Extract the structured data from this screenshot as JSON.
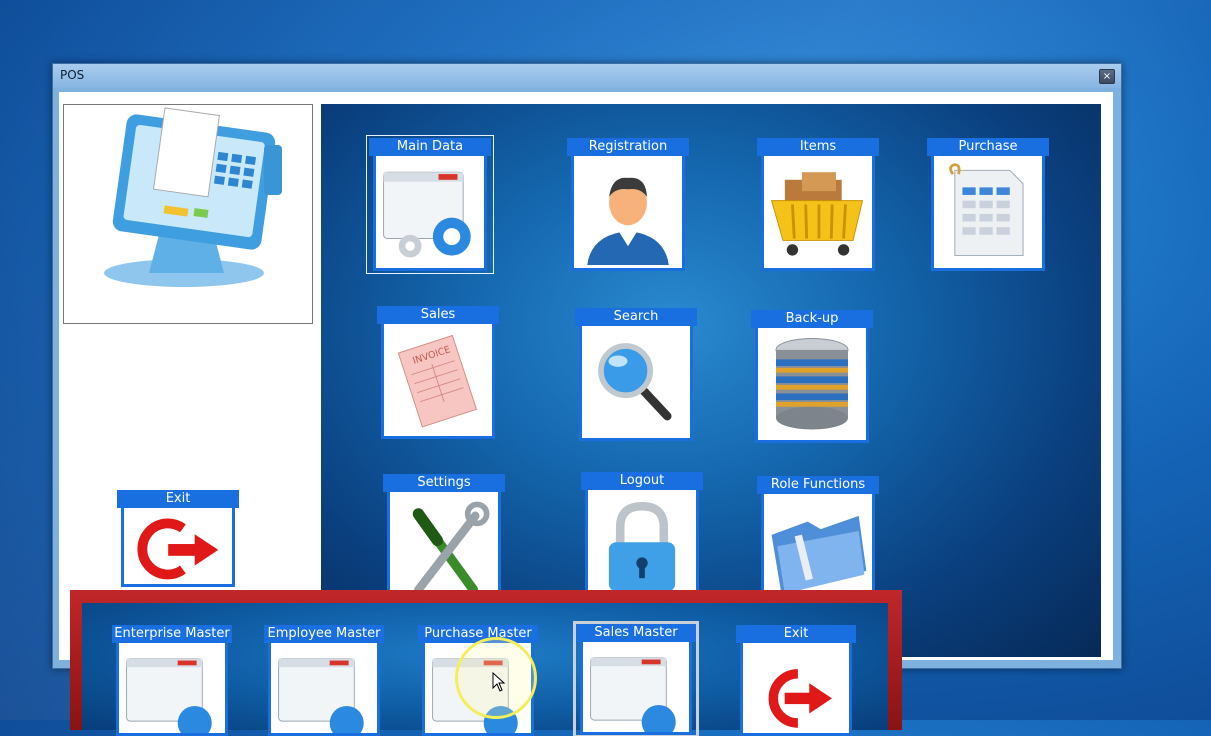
{
  "window": {
    "title": "POS",
    "close_glyph": "×"
  },
  "side": {
    "exit_label": "Exit"
  },
  "tiles": [
    {
      "label": "Main Data",
      "icon": "main-data-icon"
    },
    {
      "label": "Registration",
      "icon": "person-icon"
    },
    {
      "label": "Items",
      "icon": "shopping-basket-icon"
    },
    {
      "label": "Purchase",
      "icon": "spreadsheet-icon"
    },
    {
      "label": "Sales",
      "icon": "invoice-icon"
    },
    {
      "label": "Search",
      "icon": "magnifier-icon"
    },
    {
      "label": "Back-up",
      "icon": "database-icon"
    },
    {
      "label": "Settings",
      "icon": "tools-icon"
    },
    {
      "label": "Logout",
      "icon": "padlock-icon"
    },
    {
      "label": "Role Functions",
      "icon": "folder-icon"
    }
  ],
  "popup_tiles": [
    {
      "label": "Enterprise Master",
      "icon": "main-data-icon"
    },
    {
      "label": "Employee Master",
      "icon": "main-data-icon"
    },
    {
      "label": "Purchase Master",
      "icon": "main-data-icon"
    },
    {
      "label": "Sales Master",
      "icon": "main-data-icon"
    },
    {
      "label": "Exit",
      "icon": "exit-icon"
    }
  ],
  "colors": {
    "tile_header": "#1a6fe0",
    "panel": "#1466ad",
    "popup_frame": "#c0272a"
  }
}
